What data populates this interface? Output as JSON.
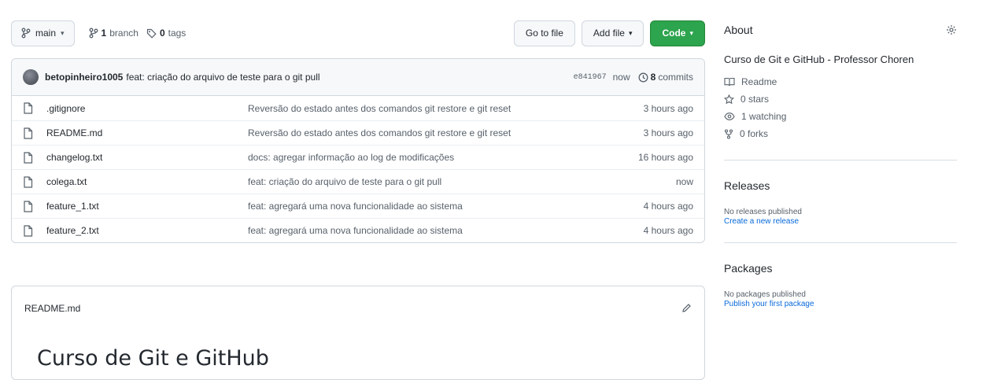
{
  "toolbar": {
    "branch_label": "main",
    "branches_count": "1",
    "branches_text": "branch",
    "tags_count": "0",
    "tags_text": "tags",
    "go_to_file": "Go to file",
    "add_file": "Add file",
    "code": "Code"
  },
  "commit": {
    "author": "betopinheiro1005",
    "prefix": "feat:",
    "message": "criação do arquivo de teste para o git pull",
    "hash": "e841967",
    "time": "now",
    "commits_count": "8",
    "commits_text": "commits"
  },
  "files": [
    {
      "name": ".gitignore",
      "message": "Reversão do estado antes dos comandos git restore e git reset",
      "time": "3 hours ago"
    },
    {
      "name": "README.md",
      "message": "Reversão do estado antes dos comandos git restore e git reset",
      "time": "3 hours ago"
    },
    {
      "name": "changelog.txt",
      "message": "docs: agregar informação ao log de modificações",
      "time": "16 hours ago"
    },
    {
      "name": "colega.txt",
      "message": "feat: criação do arquivo de teste para o git pull",
      "time": "now"
    },
    {
      "name": "feature_1.txt",
      "message": "feat: agregará uma nova funcionalidade ao sistema",
      "time": "4 hours ago"
    },
    {
      "name": "feature_2.txt",
      "message": "feat: agregará uma nova funcionalidade ao sistema",
      "time": "4 hours ago"
    }
  ],
  "readme": {
    "filename": "README.md",
    "heading": "Curso de Git e GitHub"
  },
  "about": {
    "title": "About",
    "description": "Curso de Git e GitHub - Professor Choren",
    "readme": "Readme",
    "stars": "0 stars",
    "watching": "1 watching",
    "forks": "0 forks"
  },
  "releases": {
    "title": "Releases",
    "none": "No releases published",
    "create": "Create a new release"
  },
  "packages": {
    "title": "Packages",
    "none": "No packages published",
    "publish": "Publish your first package"
  },
  "colors": {
    "code_button": "#2da44e",
    "link": "#0969da"
  }
}
